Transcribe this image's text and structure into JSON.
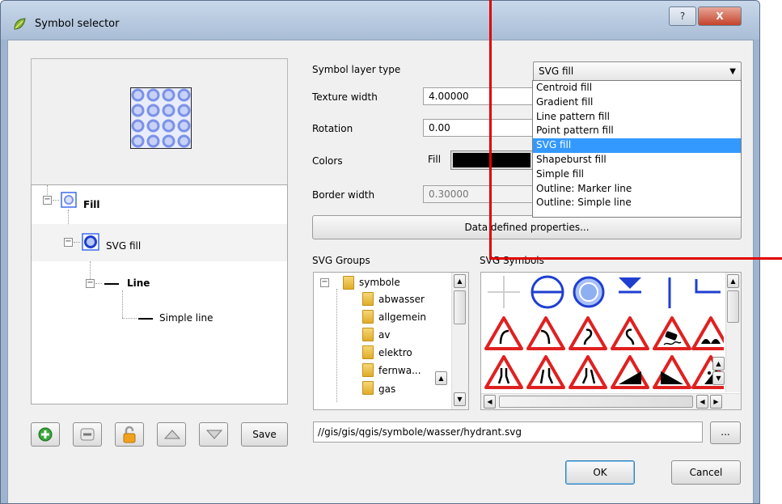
{
  "window": {
    "title": "Symbol selector",
    "help_label": "?",
    "close_label": "X"
  },
  "tree": {
    "items": [
      {
        "label": "Fill",
        "bold": true
      },
      {
        "label": "SVG fill",
        "bold": false
      },
      {
        "label": "Line",
        "bold": true
      },
      {
        "label": "Simple line",
        "bold": false
      }
    ]
  },
  "buttons": {
    "save": "Save",
    "ok": "OK",
    "cancel": "Cancel",
    "browse": "..."
  },
  "form": {
    "layer_type_label": "Symbol layer type",
    "layer_type_value": "SVG fill",
    "texture_width_label": "Texture width",
    "texture_width_value": "4.00000",
    "rotation_label": "Rotation",
    "rotation_value": "0.00",
    "colors_label": "Colors",
    "fill_label": "Fill",
    "border_width_label": "Border width",
    "border_width_value": "0.30000",
    "data_defined_label": "Data defined properties..."
  },
  "dropdown": {
    "options": [
      "Centroid fill",
      "Gradient fill",
      "Line pattern fill",
      "Point pattern fill",
      "SVG fill",
      "Shapeburst fill",
      "Simple fill",
      "Outline: Marker line",
      "Outline: Simple line"
    ],
    "selected_index": 4
  },
  "svg_groups": {
    "label": "SVG Groups",
    "items": [
      "symbole",
      "abwasser",
      "allgemein",
      "av",
      "elektro",
      "fernwa...",
      "gas"
    ]
  },
  "svg_symbols": {
    "label": "SVG Symbols"
  },
  "path": {
    "value": "//gis/gis/qgis/symbole/wasser/hydrant.svg"
  },
  "colors": {
    "annotation_line": "#e00000",
    "selection": "#3399ff",
    "symbol_blue": "#1f3fd0",
    "warning_red": "#e02020"
  }
}
